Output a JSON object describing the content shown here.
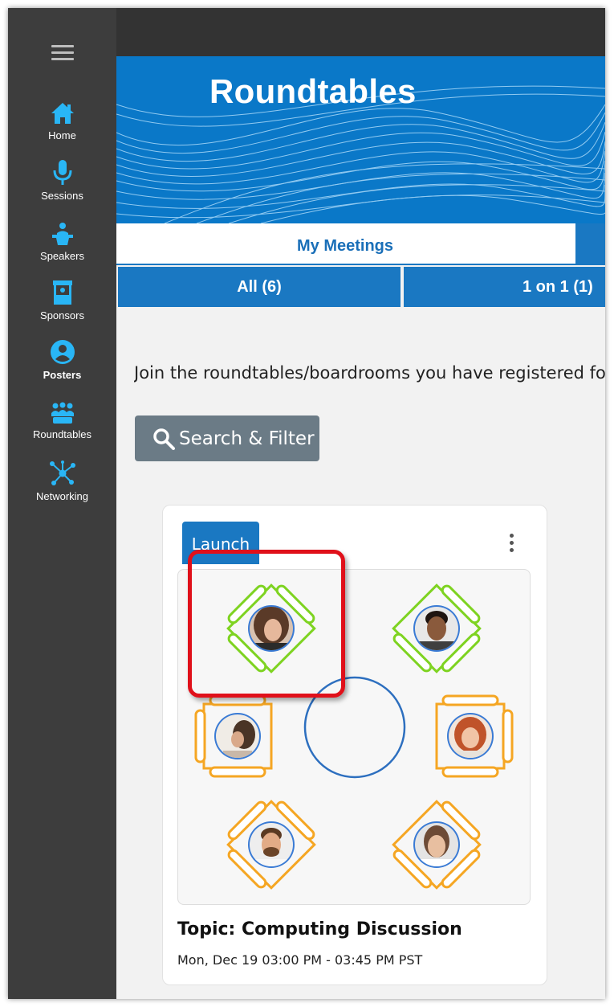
{
  "sidebar": {
    "menu_icon": "hamburger-menu-icon",
    "items": [
      {
        "label": "Home",
        "icon": "home-icon",
        "active": false
      },
      {
        "label": "Sessions",
        "icon": "microphone-icon",
        "active": false
      },
      {
        "label": "Speakers",
        "icon": "podium-icon",
        "active": false
      },
      {
        "label": "Sponsors",
        "icon": "booth-icon",
        "active": false
      },
      {
        "label": "Posters",
        "icon": "user-circle-icon",
        "active": true
      },
      {
        "label": "Roundtables",
        "icon": "group-icon",
        "active": false
      },
      {
        "label": "Networking",
        "icon": "network-icon",
        "active": false
      }
    ]
  },
  "banner": {
    "title": "Roundtables"
  },
  "tabs": {
    "primary": [
      {
        "label": "My Meetings",
        "selected": true
      }
    ],
    "secondary": [
      {
        "label": "All (6)"
      },
      {
        "label": "1 on 1 (1)"
      }
    ]
  },
  "content": {
    "intro_text": "Join the roundtables/boardrooms you have registered fo",
    "search_label": "Search & Filter",
    "search_icon": "search-icon"
  },
  "card": {
    "launch_label": "Launch",
    "menu_icon": "more-vertical-icon",
    "topic": "Topic: Computing Discussion",
    "schedule": "Mon, Dec 19 03:00 PM - 03:45 PM PST",
    "seats": [
      {
        "status": "available",
        "occupant": "woman-curly-hair"
      },
      {
        "status": "available",
        "occupant": "man-smiling"
      },
      {
        "status": "taken",
        "occupant": "woman-looking-down"
      },
      {
        "status": "taken",
        "occupant": "woman-red-hair"
      },
      {
        "status": "taken",
        "occupant": "man-beard"
      },
      {
        "status": "taken",
        "occupant": "woman-smiling"
      }
    ]
  },
  "colors": {
    "sidebar_bg": "#3d3d3d",
    "accent_icon": "#29b6f6",
    "primary_blue": "#1a78c2",
    "available_seat": "#7ed321",
    "taken_seat": "#f5a623",
    "highlight": "#e0101a"
  }
}
